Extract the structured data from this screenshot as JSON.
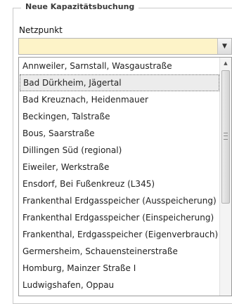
{
  "form": {
    "legend": "Neue Kapazitätsbuchung",
    "field_label": "Netzpunkt",
    "input_value": ""
  },
  "dropdown": {
    "items": [
      "Annweiler, Sarnstall, Wasgaustraße",
      "Bad Dürkheim, Jägertal",
      "Bad Kreuznach, Heidenmauer",
      "Beckingen, Talstraße",
      "Bous, Saarstraße",
      "Dillingen Süd (regional)",
      "Eiweiler, Werkstraße",
      "Ensdorf, Bei Fußenkreuz (L345)",
      "Frankenthal Erdgasspeicher (Ausspeicherung)",
      "Frankenthal Erdgasspeicher (Einspeicherung)",
      "Frankenthal, Erdgasspeicher (Eigenverbrauch)",
      "Germersheim, Schauensteinerstraße",
      "Homburg, Mainzer Straße I",
      "Ludwigshafen, Oppau"
    ],
    "selected_index": 1
  },
  "icons": {
    "combo_trigger": "chevron-down-icon",
    "scroll_up": "scroll-up-arrow-icon"
  },
  "colors": {
    "input_bg": "#fdf3c8",
    "selected_bg": "#ececec"
  }
}
